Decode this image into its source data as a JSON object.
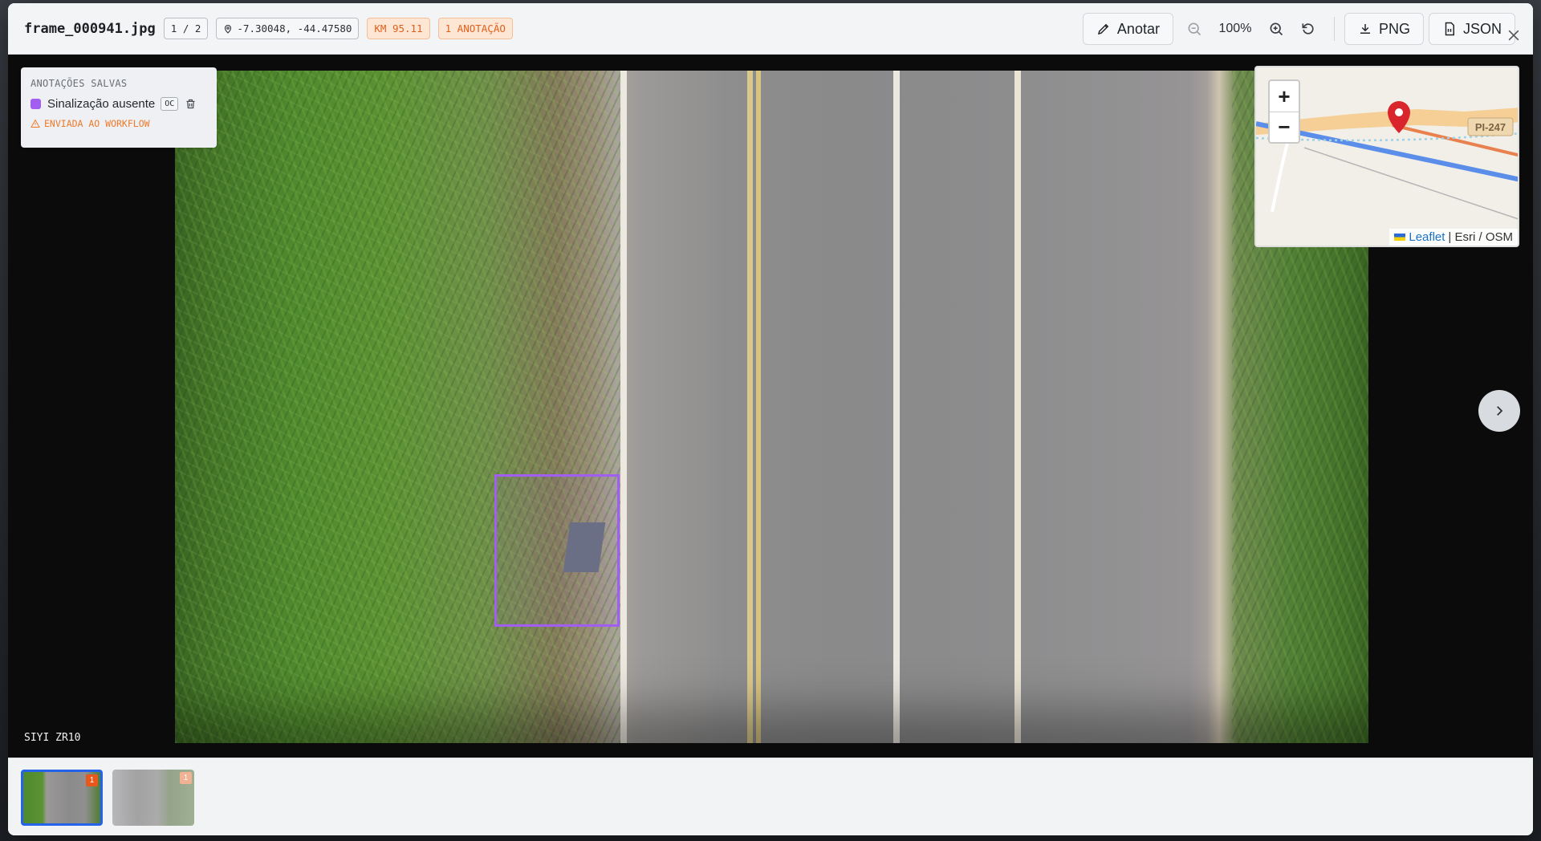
{
  "header": {
    "filename": "frame_000941.jpg",
    "counter": "1 / 2",
    "coords": "-7.30048, -44.47580",
    "km": "KM 95.11",
    "annotation_count": "1 ANOTAÇÃO",
    "annotate_label": "Anotar",
    "zoom": "100%",
    "png_label": "PNG",
    "json_label": "JSON"
  },
  "saved_panel": {
    "title": "ANOTAÇÕES SALVAS",
    "item_label": "Sinalização ausente",
    "item_code": "OC",
    "item_color": "#a25ef0",
    "status": "ENVIADA AO WORKFLOW"
  },
  "viewer": {
    "device": "SIYI ZR10"
  },
  "map": {
    "road_label": "PI-247",
    "attribution_link": "Leaflet",
    "attribution_text": "| Esri / OSM",
    "zoom_in": "+",
    "zoom_out": "−"
  },
  "thumbnails": [
    {
      "badge": "1",
      "selected": true
    },
    {
      "badge": "1",
      "selected": false
    }
  ],
  "colors": {
    "accent_orange": "#e25f1a",
    "annotation_purple": "#a25ef0",
    "selected_blue": "#2563eb"
  }
}
